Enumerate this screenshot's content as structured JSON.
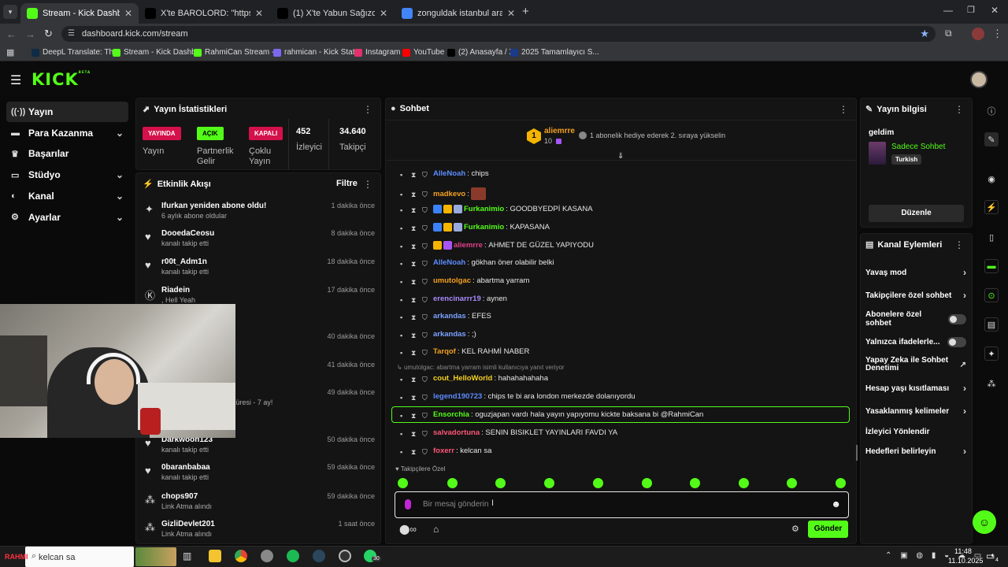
{
  "browser": {
    "tabs": [
      {
        "title": "Stream - Kick Dashboard",
        "color": "#53fc18"
      },
      {
        "title": "X'te BAROLORD: \"https://t.co/w",
        "color": "#000000"
      },
      {
        "title": "(1) X'te Yabun Sağızcıoğlu: \"",
        "color": "#000000"
      },
      {
        "title": "zonguldak istanbul arası kaç km",
        "color": "#4285f4"
      }
    ],
    "url": "dashboard.kick.com/stream",
    "bookmarks": [
      {
        "label": "DeepL Translate: Th...",
        "color": "#0f2b46"
      },
      {
        "label": "Stream - Kick Dashb...",
        "color": "#53fc18"
      },
      {
        "label": "RahmiCan Stream -...",
        "color": "#53fc18"
      },
      {
        "label": "rahmican - Kick Stat...",
        "color": "#7b68ee"
      },
      {
        "label": "Instagram",
        "color": "#e1306c"
      },
      {
        "label": "YouTube",
        "color": "#ff0000"
      },
      {
        "label": "(2) Anasayfa / X",
        "color": "#000000"
      },
      {
        "label": "2025 Tamamlayıcı S...",
        "color": "#1a3a8a"
      }
    ]
  },
  "kick": {
    "logo": "KICK",
    "logo_sup": "BETA",
    "nav": [
      {
        "label": "Yayın",
        "icon": "broadcast-icon",
        "active": true,
        "chev": false
      },
      {
        "label": "Para Kazanma",
        "icon": "wallet-icon",
        "chev": true
      },
      {
        "label": "Başarılar",
        "icon": "trophy-icon",
        "chev": false
      },
      {
        "label": "Stüdyo",
        "icon": "studio-icon",
        "chev": true
      },
      {
        "label": "Kanal",
        "icon": "channel-icon",
        "chev": true
      },
      {
        "label": "Ayarlar",
        "icon": "gear-icon",
        "chev": true
      }
    ],
    "stats": {
      "title": "Yayın İstatistikleri",
      "yayin_tag": "YAYINDA",
      "yayin_label": "Yayın",
      "partner_tag": "AÇIK",
      "partner_label1": "Partnerlik",
      "partner_label2": "Gelir",
      "coklu_tag": "KAPALI",
      "coklu_label1": "Çoklu",
      "coklu_label2": "Yayın",
      "viewers": "452",
      "viewers_label": "İzleyici",
      "followers": "34.640",
      "followers_label": "Takipçi"
    },
    "activity": {
      "title": "Etkinlik Akışı",
      "filter": "Filtre",
      "items": [
        {
          "name": "Ifurkan yeniden abone oldu!",
          "sub": "6 aylık abone oldular",
          "time": "1 dakika önce",
          "icon": "sparkle-icon"
        },
        {
          "name": "DooedaCeosu",
          "sub": "kanalı takip etti",
          "time": "8 dakika önce",
          "icon": "heart-icon"
        },
        {
          "name": "r00t_Adm1n",
          "sub": "kanalı takip etti",
          "time": "18 dakika önce",
          "icon": "heart-icon"
        },
        {
          "name": "Riadein",
          "sub": ", Hell Yeah",
          "time": "17 dakika önce",
          "icon": "kick-icon"
        },
        {
          "name": "",
          "sub": "",
          "time": "40 dakika önce",
          "icon": ""
        },
        {
          "name": "",
          "sub": "",
          "time": "41 dakika önce",
          "icon": ""
        },
        {
          "name": "",
          "sub": "uyor! Toplam abonelik süresi - 7 ay!",
          "time": "49 dakika önce",
          "icon": ""
        },
        {
          "name": "Darkwoon123",
          "sub": "kanalı takip etti",
          "time": "50 dakika önce",
          "icon": "heart-icon"
        },
        {
          "name": "0baranbabaa",
          "sub": "kanalı takip etti",
          "time": "59 dakika önce",
          "icon": "heart-icon"
        },
        {
          "name": "chops907",
          "sub": "Link Atma alındı",
          "time": "59 dakika önce",
          "icon": "points-icon"
        },
        {
          "name": "GizliDevlet201",
          "sub": "Link Atma alındı",
          "time": "1 saat önce",
          "icon": "points-icon"
        }
      ]
    },
    "chat": {
      "title": "Sohbet",
      "pinned_user": "aliemrre",
      "pinned_count": "10",
      "pinned_rank": "1",
      "pinned_msg": "1 abonelik hediye ederek 2. sıraya yükselin",
      "reply_note": "umutolgac: abartma yarram isimli kullanıcıya yanıt veriyor",
      "messages": [
        {
          "user": "AlleNoah",
          "color": "#5b8cff",
          "text": "chips",
          "badges": []
        },
        {
          "user": "madkevo",
          "color": "#f4a020",
          "text": "",
          "badges": [],
          "image": true
        },
        {
          "user": "Furkanimio",
          "color": "#53fc18",
          "text": "GOODBYEDPİ KASANA",
          "badges": [
            "#3b82f6",
            "#f4b400",
            "#9ad"
          ]
        },
        {
          "user": "Furkanimio",
          "color": "#53fc18",
          "text": "KAPASANA",
          "badges": [
            "#3b82f6",
            "#f4b400",
            "#9ad"
          ]
        },
        {
          "user": "aliemrre",
          "color": "#e0408a",
          "text": "AHMET DE GÜZEL YAPIYODU",
          "badges": [
            "#f4b400",
            "#a855f7"
          ]
        },
        {
          "user": "AlleNoah",
          "color": "#5b8cff",
          "text": "gökhan öner olabilir belki",
          "badges": []
        },
        {
          "user": "umutolgac",
          "color": "#f4a020",
          "text": "abartma yarram",
          "badges": []
        },
        {
          "user": "erencinarrr19",
          "color": "#a78bfa",
          "text": "aynen",
          "badges": []
        },
        {
          "user": "arkandas",
          "color": "#7aa2ff",
          "text": "EFES",
          "badges": []
        },
        {
          "user": "arkandas",
          "color": "#7aa2ff",
          "text": ";)",
          "badges": []
        },
        {
          "user": "Tarqof",
          "color": "#f4a020",
          "text": "KEL RAHMİ NABER",
          "badges": []
        },
        {
          "user": "cout_HelloWorld",
          "color": "#f4d020",
          "text": "hahahahahaha",
          "badges": []
        },
        {
          "user": "legend190723",
          "color": "#5b8cff",
          "text": "chips te bi ara london merkezde dolanıyordu",
          "badges": []
        },
        {
          "user": "Ensorchia",
          "color": "#53fc18",
          "text": "oguzjapan vardı hala yayın yapıyomu kickte baksana bi @RahmiCan",
          "badges": [],
          "highlight": true
        },
        {
          "user": "salvadortuna",
          "color": "#ff5577",
          "text": "SENIN BISIKLET YAYINLARI FAVDI YA",
          "badges": []
        },
        {
          "user": "foxerr",
          "color": "#ff5577",
          "text": "kelcan sa",
          "badges": []
        }
      ],
      "followers_only": "Takipçilere Özel",
      "input_placeholder": "Bir mesaj gönderin",
      "send": "Gönder"
    },
    "info": {
      "title": "Yayın bilgisi",
      "stream_title": "geldim",
      "category": "Sadece Sohbet",
      "language": "Turkish",
      "edit": "Düzenle"
    },
    "actions": {
      "title": "Kanal Eylemleri",
      "items": [
        {
          "label": "Yavaş mod",
          "type": "chev"
        },
        {
          "label": "Takipçilere özel sohbet",
          "type": "chev"
        },
        {
          "label": "Abonelere özel sohbet",
          "type": "toggle"
        },
        {
          "label": "Yalnızca ifadelerle...",
          "type": "toggle"
        },
        {
          "label": "Yapay Zeka ile Sohbet Denetimi",
          "type": "ext"
        },
        {
          "label": "Hesap yaşı kısıtlaması",
          "type": "chev"
        },
        {
          "label": "Yasaklanmış kelimeler",
          "type": "chev"
        },
        {
          "label": "İzleyici Yönlendir",
          "type": "none"
        },
        {
          "label": "Hedefleri belirleyin",
          "type": "chev"
        }
      ]
    }
  },
  "taskbar": {
    "search_text": "kelcan sa",
    "clock_time": "11:48",
    "clock_date": "11.10.2025",
    "whatsapp_badge": "30",
    "notif_count": "4"
  }
}
